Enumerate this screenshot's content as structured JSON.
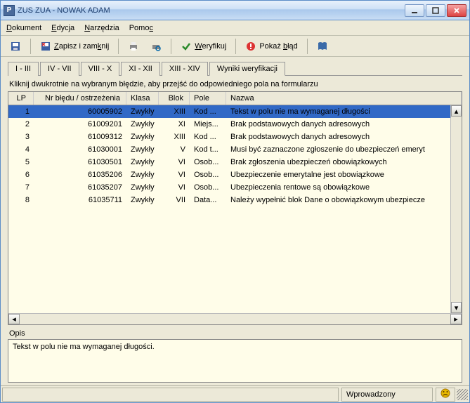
{
  "window": {
    "title": "ZUS ZUA - NOWAK ADAM"
  },
  "menu": {
    "dokument": "Dokument",
    "edycja": "Edycja",
    "narzedzia": "Narzędzia",
    "pomoc": "Pomoc"
  },
  "toolbar": {
    "zapisz_zamknij": "Zapisz i zamknij",
    "weryfikuj": "Weryfikuj",
    "pokaz_blad": "Pokaż błąd"
  },
  "tabs": {
    "t1": "I - III",
    "t2": "IV - VII",
    "t3": "VIII - X",
    "t4": "XI - XII",
    "t5": "XIII - XIV",
    "t6": "Wyniki weryfikacji"
  },
  "hint": "Kliknij dwukrotnie na wybranym błędzie, aby przejść do odpowiedniego pola na formularzu",
  "cols": {
    "lp": "LP",
    "nr": "Nr błędu / ostrzeżenia",
    "klasa": "Klasa",
    "blok": "Blok",
    "pole": "Pole",
    "nazwa": "Nazwa"
  },
  "rows": [
    {
      "lp": "1",
      "nr": "60005902",
      "klasa": "Zwykły",
      "blok": "XIII",
      "pole": "Kod ...",
      "nazwa": "Tekst w polu nie ma wymaganej długości"
    },
    {
      "lp": "2",
      "nr": "61009201",
      "klasa": "Zwykły",
      "blok": "XI",
      "pole": "Miejs...",
      "nazwa": "Brak podstawowych danych adresowych"
    },
    {
      "lp": "3",
      "nr": "61009312",
      "klasa": "Zwykły",
      "blok": "XIII",
      "pole": "Kod ...",
      "nazwa": "Brak podstawowych danych adresowych"
    },
    {
      "lp": "4",
      "nr": "61030001",
      "klasa": "Zwykły",
      "blok": "V",
      "pole": "Kod t...",
      "nazwa": "Musi być zaznaczone zgłoszenie do ubezpieczeń emeryt"
    },
    {
      "lp": "5",
      "nr": "61030501",
      "klasa": "Zwykły",
      "blok": "VI",
      "pole": "Osob...",
      "nazwa": "Brak zgłoszenia ubezpieczeń obowiązkowych"
    },
    {
      "lp": "6",
      "nr": "61035206",
      "klasa": "Zwykły",
      "blok": "VI",
      "pole": "Osob...",
      "nazwa": "Ubezpieczenie emerytalne jest obowiązkowe"
    },
    {
      "lp": "7",
      "nr": "61035207",
      "klasa": "Zwykły",
      "blok": "VI",
      "pole": "Osob...",
      "nazwa": "Ubezpieczenia rentowe są obowiązkowe"
    },
    {
      "lp": "8",
      "nr": "61035711",
      "klasa": "Zwykły",
      "blok": "VII",
      "pole": "Data...",
      "nazwa": "Należy wypełnić blok Dane o obowiązkowym ubezpiecze"
    }
  ],
  "desc": {
    "label": "Opis",
    "text": "Tekst w polu nie ma wymaganej długości."
  },
  "status": {
    "state": "Wprowadzony"
  }
}
